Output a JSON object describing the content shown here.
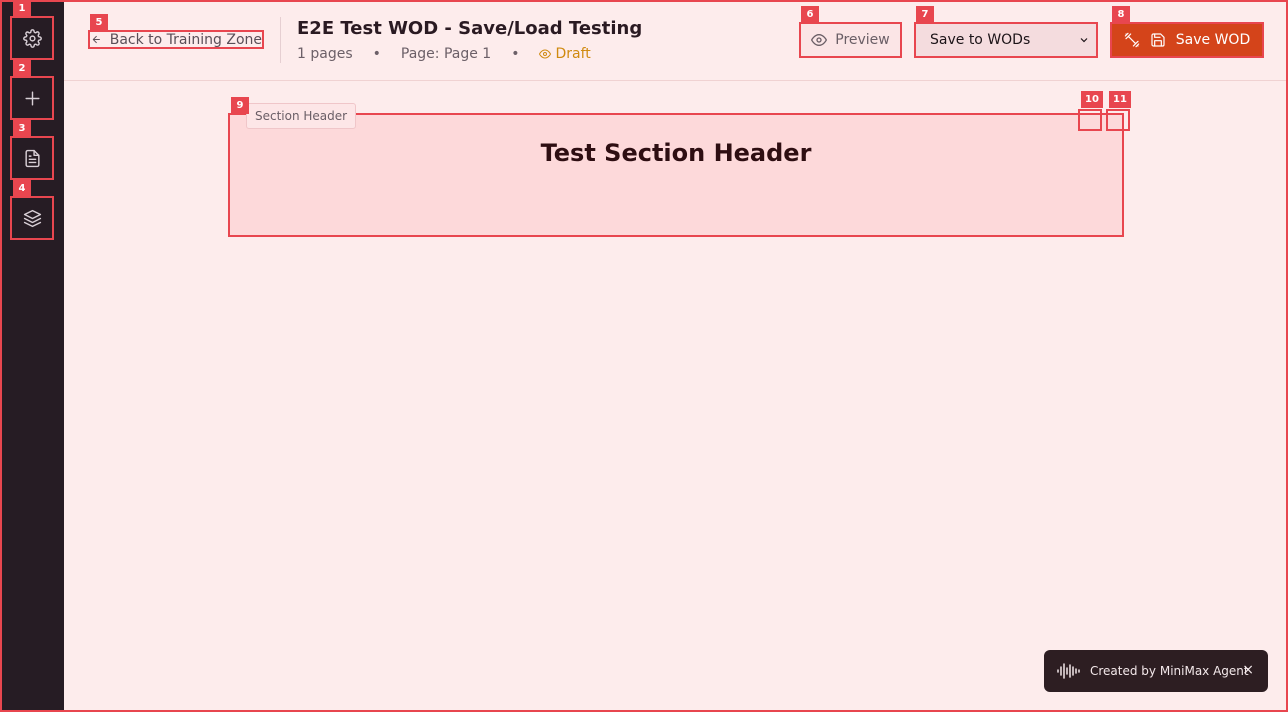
{
  "sidebar": {
    "items": [
      {
        "icon": "gear-icon",
        "badge": "1"
      },
      {
        "icon": "plus-icon",
        "badge": "2"
      },
      {
        "icon": "document-icon",
        "badge": "3"
      },
      {
        "icon": "layers-icon",
        "badge": "4"
      }
    ]
  },
  "header": {
    "back_label": "Back to Training Zone",
    "back_badge": "5",
    "title": "E2E Test WOD - Save/Load Testing",
    "meta": {
      "pages": "1 pages",
      "page": "Page: Page 1",
      "separator": "•",
      "status": "Draft"
    },
    "preview_label": "Preview",
    "preview_badge": "6",
    "select_value": "Save to WODs",
    "select_badge": "7",
    "save_label": "Save WOD",
    "save_badge": "8"
  },
  "canvas": {
    "section_badge": "9",
    "section_tag": "Section Header",
    "section_title": "Test Section Header",
    "control_badges": [
      "10",
      "11"
    ]
  },
  "toast": {
    "text": "Created by MiniMax Agent",
    "close": "×"
  },
  "colors": {
    "background": "#fdecec",
    "sidebar": "#261c24",
    "accent": "#e8464f",
    "primary_button": "#d4441a",
    "draft": "#d08a10"
  }
}
